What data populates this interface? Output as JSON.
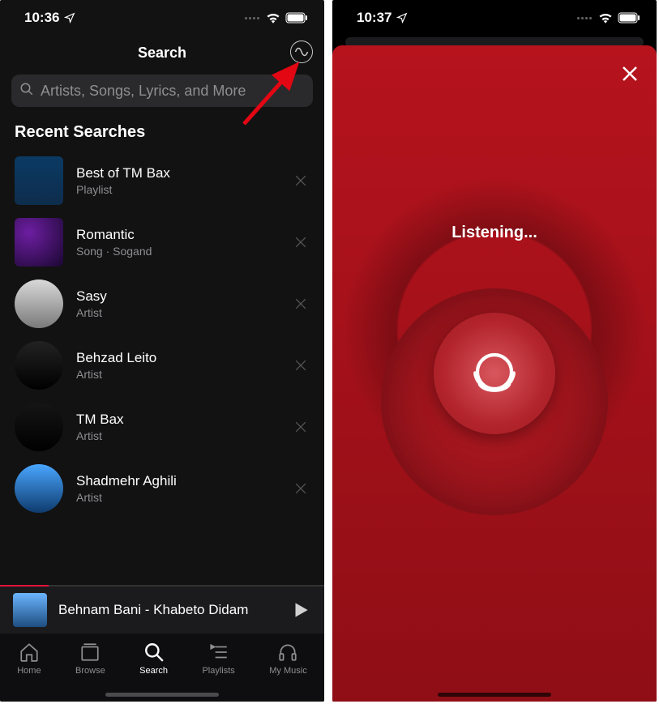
{
  "left": {
    "status": {
      "time": "10:36"
    },
    "header": {
      "title": "Search"
    },
    "search": {
      "placeholder": "Artists, Songs, Lyrics, and More"
    },
    "section_title": "Recent Searches",
    "items": [
      {
        "title": "Best of TM Bax",
        "sub": "Playlist",
        "round": false
      },
      {
        "title": "Romantic",
        "sub": "Song  ·  Sogand",
        "round": false
      },
      {
        "title": "Sasy",
        "sub": "Artist",
        "round": true
      },
      {
        "title": "Behzad Leito",
        "sub": "Artist",
        "round": true
      },
      {
        "title": "TM Bax",
        "sub": "Artist",
        "round": true
      },
      {
        "title": "Shadmehr Aghili",
        "sub": "Artist",
        "round": true
      }
    ],
    "now_playing": {
      "title": "Behnam Bani - Khabeto Didam"
    },
    "tabs": [
      {
        "label": "Home"
      },
      {
        "label": "Browse"
      },
      {
        "label": "Search"
      },
      {
        "label": "Playlists"
      },
      {
        "label": "My Music"
      }
    ]
  },
  "right": {
    "status": {
      "time": "10:37"
    },
    "listening_label": "Listening..."
  }
}
